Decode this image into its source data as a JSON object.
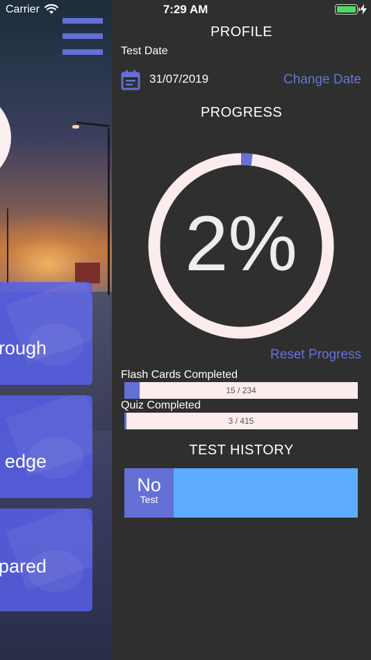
{
  "status_bar": {
    "carrier": "Carrier",
    "time": "7:29 AM"
  },
  "background": {
    "nav_cards": [
      {
        "label": "hrough"
      },
      {
        "label": "edge"
      },
      {
        "label": "prepared"
      }
    ]
  },
  "profile": {
    "title": "PROFILE",
    "test_date_label": "Test Date",
    "test_date": "31/07/2019",
    "change_date": "Change Date",
    "progress_title": "PROGRESS",
    "progress_text": "2%",
    "progress_fraction": 0.02,
    "reset_progress": "Reset Progress",
    "flash_cards_label": "Flash Cards Completed",
    "flash_cards_count": "15 / 234",
    "flash_cards_fraction": 0.064,
    "quiz_label": "Quiz Completed",
    "quiz_count": "3 / 415",
    "quiz_fraction": 0.007,
    "history_title": "TEST HISTORY",
    "history_badge_big": "No",
    "history_badge_small": "Test"
  },
  "colors": {
    "accent": "#6470d6",
    "link": "#6673d4",
    "panel_bg": "#2f2f2f",
    "track": "#fdeced",
    "history_bar": "#5eacff",
    "battery": "#4cd964"
  },
  "icons": {
    "menu": "hamburger-menu-icon",
    "calendar": "calendar-icon",
    "wifi": "wifi-icon",
    "battery": "battery-icon",
    "charging": "charging-bolt-icon"
  }
}
